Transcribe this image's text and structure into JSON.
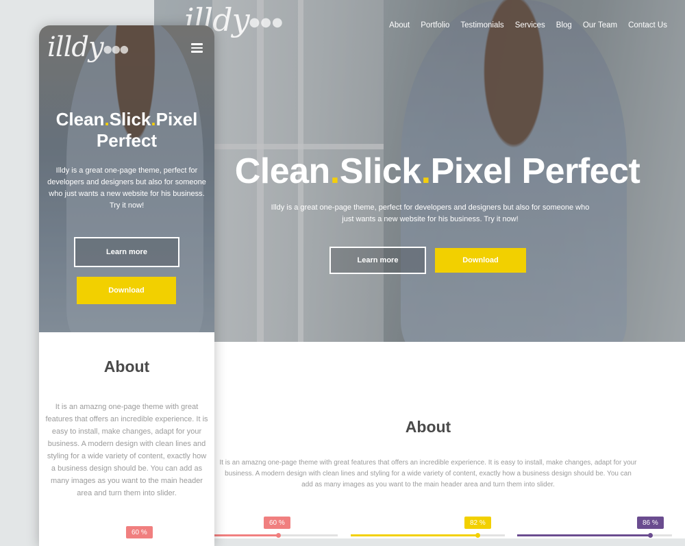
{
  "desktop": {
    "logo": "illdy",
    "logo_dots": "●●●",
    "nav": [
      "About",
      "Portfolio",
      "Testimonials",
      "Services",
      "Blog",
      "Our Team",
      "Contact Us"
    ],
    "hero": {
      "title_parts": [
        "Clean",
        ".",
        "Slick",
        ".",
        "Pixel Perfect"
      ],
      "subtitle": "Illdy is a great one-page theme, perfect for developers and designers but also for someone who just wants a new website for his business. Try it now!",
      "learn_more": "Learn more",
      "download": "Download"
    },
    "about": {
      "title": "About",
      "text": "It is an amazng one-page theme with great features that offers an incredible experience. It is easy to install, make changes, adapt for your business. A modern design with clean lines and styling for a wide variety of content, exactly how a business design should be. You can add as many images as you want to the main header area and turn them into slider."
    },
    "skills": [
      {
        "label": "60 %",
        "value": 60,
        "color": "#f07f7f"
      },
      {
        "label": "82 %",
        "value": 82,
        "color": "#f2d000"
      },
      {
        "label": "86 %",
        "value": 86,
        "color": "#6a4c8f"
      }
    ]
  },
  "mobile": {
    "logo": "illdy",
    "logo_dots": "●●●",
    "hero": {
      "title_line1_parts": [
        "Clean",
        ".",
        "Slick",
        ".",
        "Pixel"
      ],
      "title_line2": "Perfect",
      "subtitle": "Illdy is a great one-page theme, perfect for developers and designers but also for someone who just wants a new website for his business. Try it now!",
      "learn_more": "Learn more",
      "download": "Download"
    },
    "about": {
      "title": "About",
      "text": "It is an amazng one-page theme with great features that offers an incredible experience. It is easy to install, make changes, adapt for your business. A modern design with clean lines and styling for a wide variety of content, exactly how a business design should be. You can add as many images as you want to the main header area and turn them into slider."
    },
    "skill_badge": "60 %"
  },
  "colors": {
    "accent_yellow": "#f2d000",
    "dot_yellow": "#f4ce0c",
    "skill_red": "#f07f7f",
    "skill_purple": "#6a4c8f",
    "heading_gray": "#4a4a4a",
    "text_gray": "#9b9b9b"
  }
}
